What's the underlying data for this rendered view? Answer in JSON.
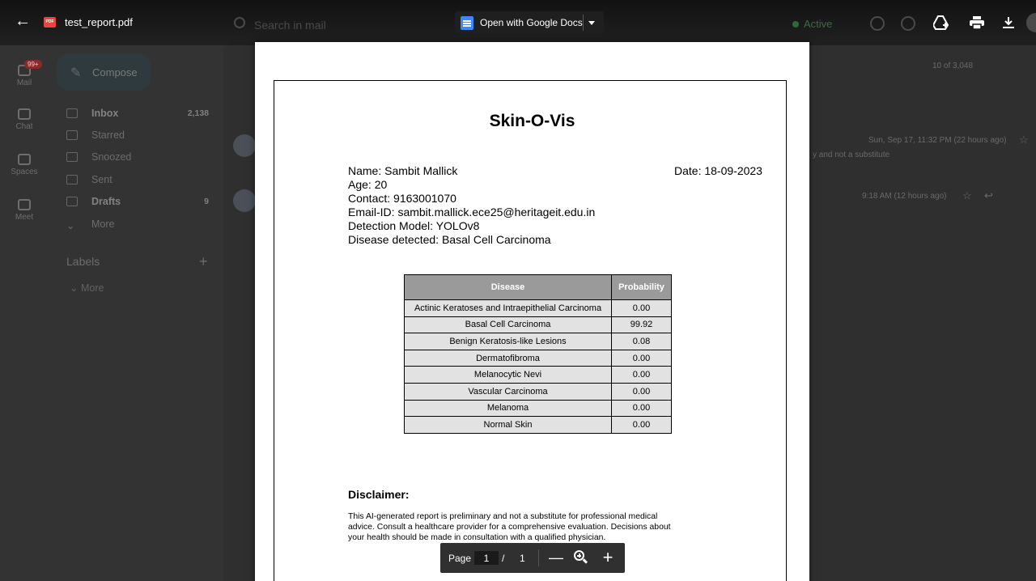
{
  "viewer": {
    "file_name": "test_report.pdf",
    "pdf_badge": "PDF",
    "back_icon": "arrow-left-icon",
    "open_with_label": "Open with Google Docs",
    "search_placeholder": "Search in mail",
    "status_label": "Active",
    "toolbar_icons": [
      "add-to-drive-icon",
      "print-icon",
      "download-icon"
    ]
  },
  "gmail": {
    "compose_label": "Compose",
    "rail": [
      {
        "label": "Mail",
        "badge": "99+"
      },
      {
        "label": "Chat"
      },
      {
        "label": "Spaces"
      },
      {
        "label": "Meet"
      }
    ],
    "nav": [
      {
        "label": "Inbox",
        "count": "2,138",
        "bold": true
      },
      {
        "label": "Starred",
        "count": ""
      },
      {
        "label": "Snoozed",
        "count": ""
      },
      {
        "label": "Sent",
        "count": ""
      },
      {
        "label": "Drafts",
        "count": "9",
        "bold": true
      },
      {
        "label": "More",
        "count": ""
      }
    ],
    "labels_heading": "Labels",
    "labels_more": "More",
    "pagination": "10 of 3,048",
    "email1_time": "Sun, Sep 17, 11:32 PM (22 hours ago)",
    "email1_snippet": "y and not a substitute",
    "email2_time": "9:18 AM (12 hours ago)"
  },
  "report": {
    "title": "Skin-O-Vis",
    "name": "Name: Sambit Mallick",
    "date": "Date: 18-09-2023",
    "age": "Age: 20",
    "contact": "Contact: 9163001070",
    "email": "Email-ID: sambit.mallick.ece25@heritageit.edu.in",
    "model": "Detection Model: YOLOv8",
    "disease": "Disease detected: Basal Cell Carcinoma",
    "table": {
      "headers": [
        "Disease",
        "Probability"
      ],
      "rows": [
        [
          "Actinic Keratoses and Intraepithelial Carcinoma",
          "0.00"
        ],
        [
          "Basal Cell Carcinoma",
          "99.92"
        ],
        [
          "Benign Keratosis-like Lesions",
          "0.08"
        ],
        [
          "Dermatofibroma",
          "0.00"
        ],
        [
          "Melanocytic Nevi",
          "0.00"
        ],
        [
          "Vascular Carcinoma",
          "0.00"
        ],
        [
          "Melanoma",
          "0.00"
        ],
        [
          "Normal Skin",
          "0.00"
        ]
      ]
    },
    "disclaimer_heading": "Disclaimer:",
    "disclaimer_lines": [
      "This AI-generated report is preliminary and not a substitute for professional medical",
      "advice. Consult a healthcare provider for a comprehensive evaluation. Decisions about",
      "your health should be made in consultation with a qualified physician."
    ]
  },
  "page_controls": {
    "page_label": "Page",
    "current_page": "1",
    "separator": "/",
    "total_pages": "1",
    "zoom_out": "—",
    "zoom_in": "+"
  }
}
